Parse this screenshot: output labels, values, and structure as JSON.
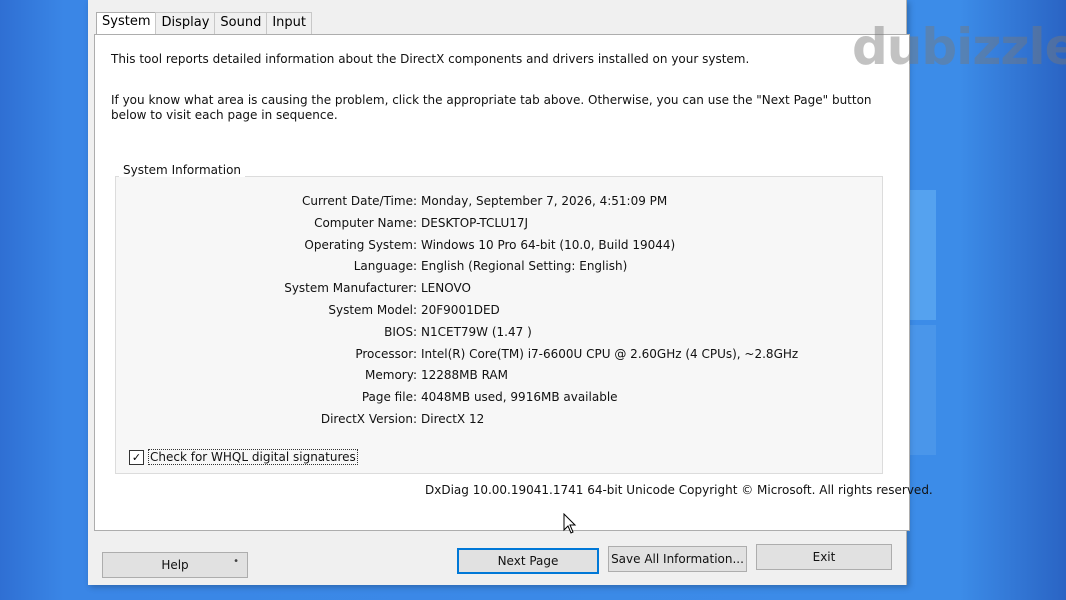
{
  "tabs": [
    "System",
    "Display",
    "Sound",
    "Input"
  ],
  "intro": {
    "line1": "This tool reports detailed information about the DirectX components and drivers installed on your system.",
    "line2": "If you know what area is causing the problem, click the appropriate tab above.  Otherwise, you can use the \"Next Page\" button below to visit each page in sequence."
  },
  "system_info": {
    "title": "System Information",
    "rows": [
      {
        "label": "Current Date/Time:",
        "value": "Monday, September 7, 2026, 4:51:09 PM"
      },
      {
        "label": "Computer Name:",
        "value": "DESKTOP-TCLU17J"
      },
      {
        "label": "Operating System:",
        "value": "Windows 10 Pro 64-bit (10.0, Build 19044)"
      },
      {
        "label": "Language:",
        "value": "English (Regional Setting: English)"
      },
      {
        "label": "System Manufacturer:",
        "value": "LENOVO"
      },
      {
        "label": "System Model:",
        "value": "20F9001DED"
      },
      {
        "label": "BIOS:",
        "value": "N1CET79W (1.47 )"
      },
      {
        "label": "Processor:",
        "value": "Intel(R) Core(TM) i7-6600U CPU @ 2.60GHz (4 CPUs), ~2.8GHz"
      },
      {
        "label": "Memory:",
        "value": "12288MB RAM"
      },
      {
        "label": "Page file:",
        "value": "4048MB used, 9916MB available"
      },
      {
        "label": "DirectX Version:",
        "value": "DirectX 12"
      }
    ]
  },
  "whql_checkbox": {
    "label": "Check for WHQL digital signatures",
    "checked": true
  },
  "footer": "DxDiag 10.00.19041.1741 64-bit Unicode  Copyright © Microsoft. All rights reserved.",
  "buttons": {
    "help": "Help",
    "next_page": "Next Page",
    "save_all": "Save All Information...",
    "exit": "Exit"
  },
  "watermark": "dubizzle"
}
